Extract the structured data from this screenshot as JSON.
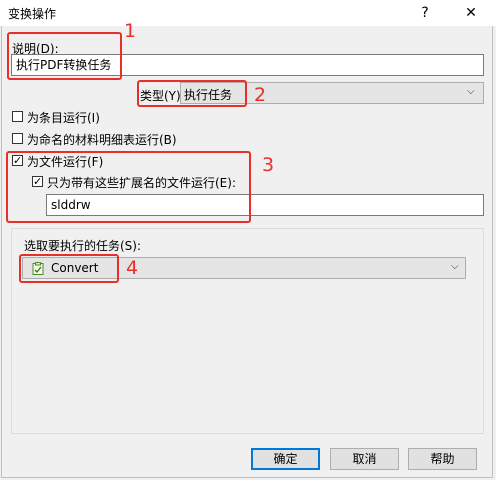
{
  "window": {
    "title": "变换操作",
    "help_glyph": "?",
    "close_glyph": "✕"
  },
  "description": {
    "label": "说明(D):",
    "value": "执行PDF转换任务"
  },
  "type": {
    "label": "类型(Y):",
    "value": "执行任务",
    "chevron": "⌵"
  },
  "options": {
    "run_for_item": {
      "label": "为条目运行(I)",
      "checked": false
    },
    "run_for_named_bom": {
      "label": "为命名的材料明细表运行(B)",
      "checked": false
    },
    "run_for_file": {
      "label": "为文件运行(F)",
      "checked": true,
      "mark": "✓"
    },
    "only_extension": {
      "label": "只为带有这些扩展名的文件运行(E):",
      "checked": true,
      "mark": "✓"
    },
    "extension_value": "slddrw"
  },
  "task": {
    "label": "选取要执行的任务(S):",
    "value": "Convert",
    "icon": "convert-task-icon",
    "chevron": "⌵"
  },
  "buttons": {
    "ok": "确定",
    "cancel": "取消",
    "help": "帮助"
  },
  "annotations": {
    "n1": "1",
    "n2": "2",
    "n3": "3",
    "n4": "4",
    "color": "#e8302a"
  }
}
